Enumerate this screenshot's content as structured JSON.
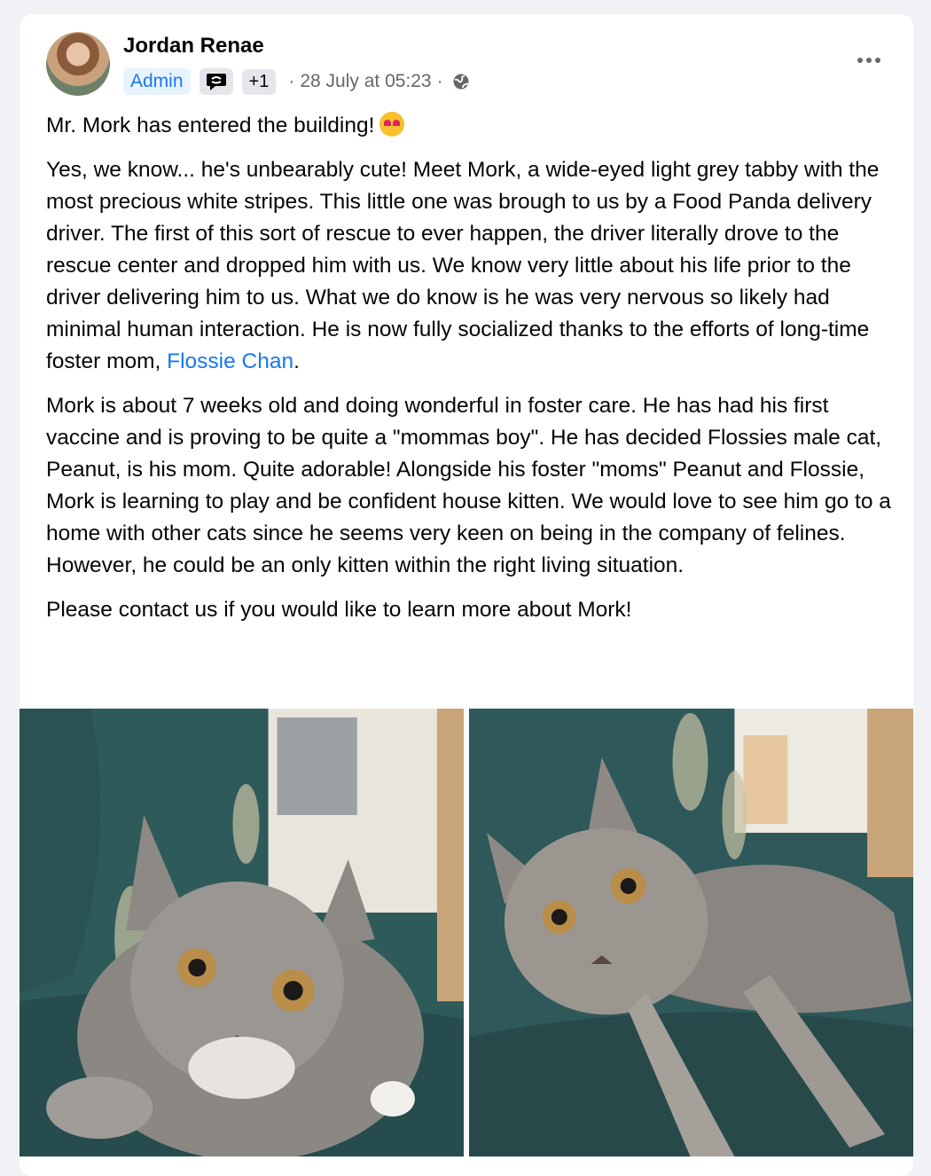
{
  "post": {
    "author": "Jordan Renae",
    "badge_admin": "Admin",
    "badge_extra": "+1",
    "timestamp": "28 July at 05:23",
    "separator": "·",
    "more_icon": "more-dots-icon",
    "privacy_icon": "globe-icon",
    "badge_icon": "conversation-starter-icon"
  },
  "content": {
    "line1": "Mr. Mork has entered the building!",
    "emoji": "heart-eyes-cat-emoji",
    "para2_before_link": "Yes, we know... he's unbearably cute! Meet Mork, a wide-eyed light grey tabby with the most precious white stripes. This little one was brough to us by a Food Panda delivery driver. The first of this sort of rescue to ever happen, the driver literally drove to the rescue center and dropped him with us. We know very little about his life prior to the driver delivering him to us. What we do know is he was very nervous so likely had minimal human interaction. He is now fully socialized thanks to the efforts of long-time foster mom, ",
    "link": "Flossie Chan",
    "para2_after_link": ".",
    "para3": "Mork is about 7 weeks old and doing wonderful in foster care. He has had his first vaccine and is proving to be quite a \"mommas boy\". He has decided Flossies male cat, Peanut, is his mom. Quite adorable! Alongside his foster \"moms\" Peanut and Flossie, Mork is learning to play and be confident house kitten. We would love to see him go to a home with other cats since he seems very keen on being in the company of felines. However, he could be an only kitten within the right living situation.",
    "para4": "Please contact us if you would like to learn more about Mork!"
  },
  "colors": {
    "link": "#1877f2",
    "admin_badge_bg": "#e7f3ff",
    "secondary_text": "#65676b"
  }
}
